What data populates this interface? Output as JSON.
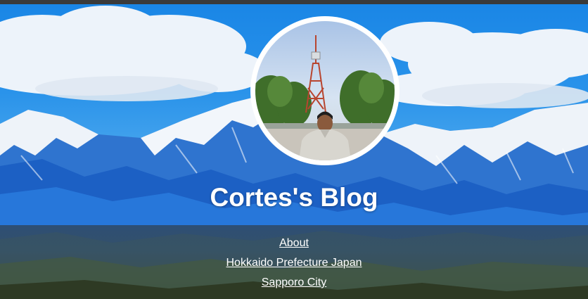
{
  "blog": {
    "title": "Cortes's Blog"
  },
  "nav": {
    "items": [
      {
        "label": "About"
      },
      {
        "label": "Hokkaido Prefecture Japan"
      },
      {
        "label": "Sapporo City"
      }
    ]
  },
  "colors": {
    "sky": "#1a86e6",
    "nav_band": "#2e4f74",
    "text": "#ffffff",
    "avatar_ring": "#ffffff"
  },
  "icons": {
    "avatar": "profile-photo-tv-tower"
  }
}
